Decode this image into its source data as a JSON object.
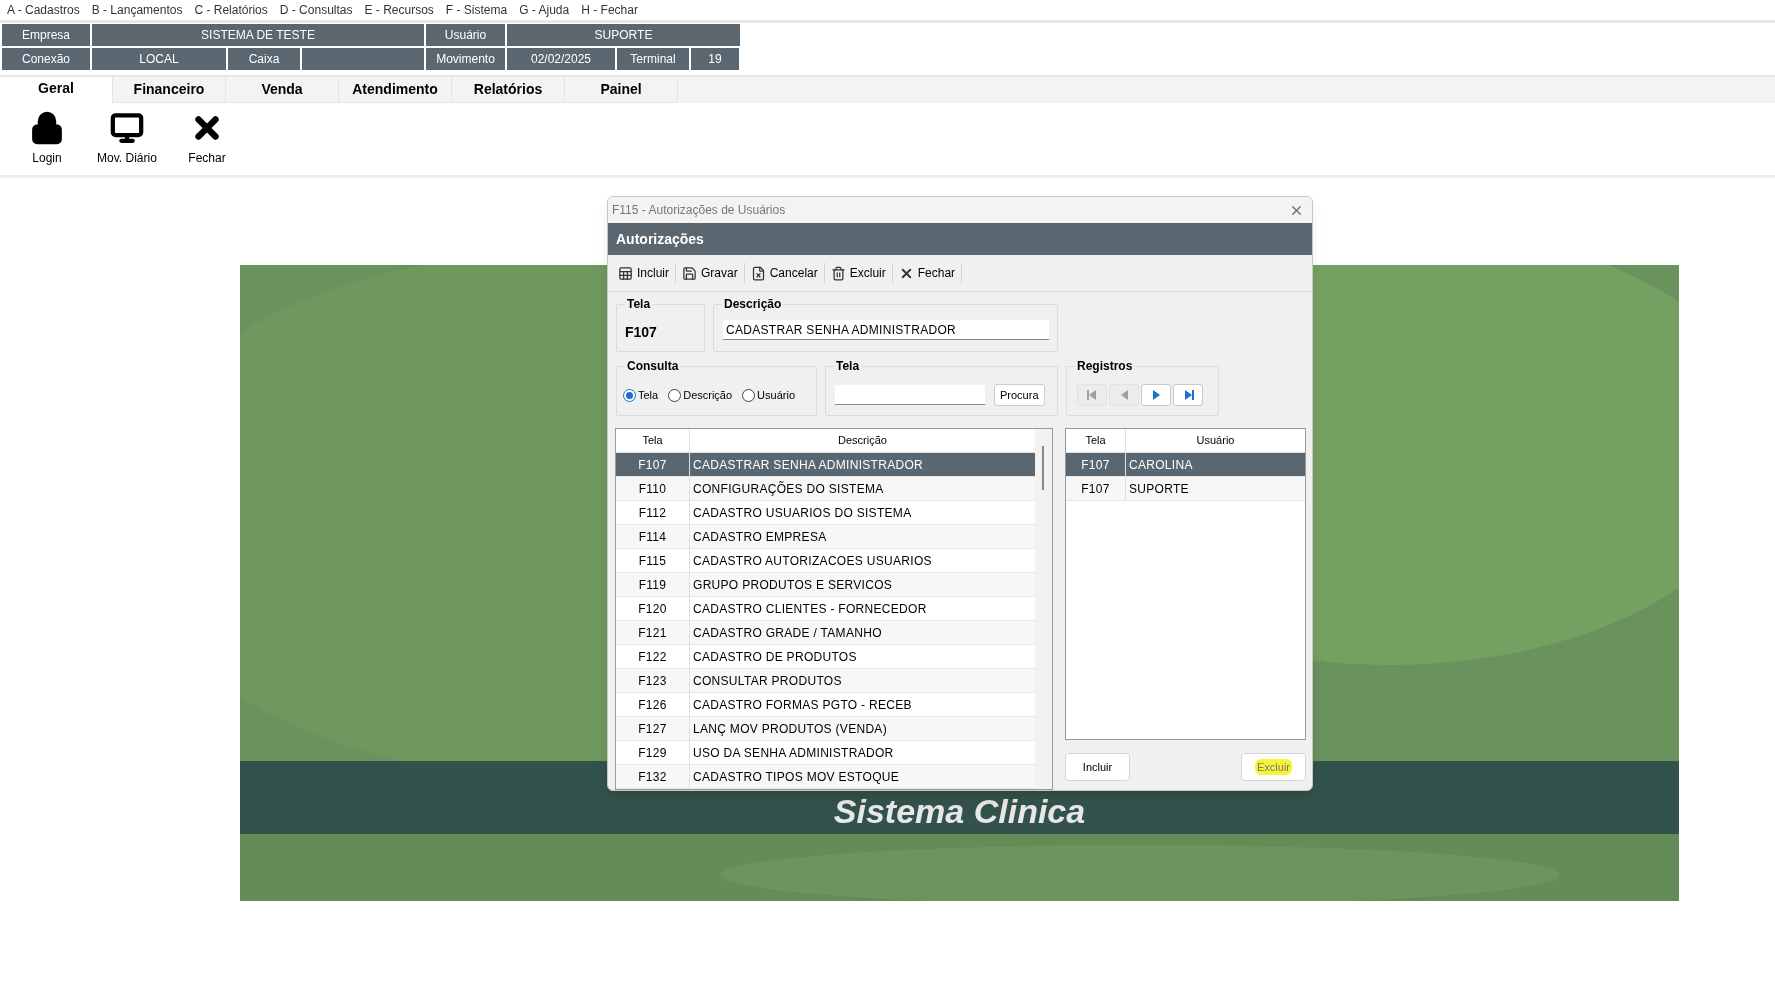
{
  "menu": [
    "A - Cadastros",
    "B - Lançamentos",
    "C - Relatórios",
    "D - Consultas",
    "E - Recursos",
    "F - Sistema",
    "G - Ajuda",
    "H - Fechar"
  ],
  "info_rows": [
    [
      "Empresa",
      "SISTEMA DE TESTE",
      "Usuário",
      "SUPORTE"
    ],
    [
      "Conexão",
      "LOCAL",
      "Caixa",
      "",
      "Movimento",
      "02/02/2025",
      "Terminal",
      "19"
    ]
  ],
  "tabs": [
    {
      "label": "Geral",
      "selected": true
    },
    {
      "label": "Financeiro",
      "selected": false
    },
    {
      "label": "Venda",
      "selected": false
    },
    {
      "label": "Atendimento",
      "selected": false
    },
    {
      "label": "Relatórios",
      "selected": false
    },
    {
      "label": "Painel",
      "selected": false
    }
  ],
  "ribbon": [
    {
      "kind": "lock",
      "label": "Login"
    },
    {
      "kind": "computer",
      "label": "Mov. Diário"
    },
    {
      "kind": "close",
      "label": "Fechar"
    }
  ],
  "background": {
    "banner_text": "Sistema Clinica"
  },
  "dialog": {
    "title": "F115 - Autorizações de Usuários",
    "header": "Autorizações",
    "toolbar": [
      {
        "kind": "add",
        "label": "Incluir"
      },
      {
        "kind": "save",
        "label": "Gravar"
      },
      {
        "kind": "cancel",
        "label": "Cancelar"
      },
      {
        "kind": "delete",
        "label": "Excluir"
      },
      {
        "kind": "close",
        "label": "Fechar"
      }
    ],
    "tela": {
      "label": "Tela",
      "value": "F107"
    },
    "descricao": {
      "label": "Descrição",
      "value": "CADASTRAR SENHA ADMINISTRADOR"
    },
    "consulta": {
      "label": "Consulta",
      "options": [
        {
          "label": "Tela",
          "selected": true
        },
        {
          "label": "Descrição",
          "selected": false
        },
        {
          "label": "Usuário",
          "selected": false
        }
      ]
    },
    "search": {
      "label": "Tela",
      "button": "Procura"
    },
    "registros": {
      "label": "Registros",
      "buttons": [
        {
          "kind": "first",
          "disabled": true
        },
        {
          "kind": "prev",
          "disabled": true
        },
        {
          "kind": "next",
          "disabled": false
        },
        {
          "kind": "last",
          "disabled": false
        }
      ]
    },
    "screens_table": {
      "columns": [
        "Tela",
        "Descrição"
      ],
      "rows": [
        {
          "cells": [
            "F107",
            "CADASTRAR SENHA ADMINISTRADOR"
          ],
          "selected": true
        },
        {
          "cells": [
            "F110",
            "CONFIGURAÇÕES DO SISTEMA"
          ],
          "selected": false
        },
        {
          "cells": [
            "F112",
            "CADASTRO USUARIOS DO SISTEMA"
          ],
          "selected": false
        },
        {
          "cells": [
            "F114",
            "CADASTRO EMPRESA"
          ],
          "selected": false
        },
        {
          "cells": [
            "F115",
            "CADASTRO AUTORIZACOES USUARIOS"
          ],
          "selected": false
        },
        {
          "cells": [
            "F119",
            "GRUPO PRODUTOS E SERVICOS"
          ],
          "selected": false
        },
        {
          "cells": [
            "F120",
            "CADASTRO CLIENTES - FORNECEDOR"
          ],
          "selected": false
        },
        {
          "cells": [
            "F121",
            "CADASTRO GRADE / TAMANHO"
          ],
          "selected": false
        },
        {
          "cells": [
            "F122",
            "CADASTRO DE PRODUTOS"
          ],
          "selected": false
        },
        {
          "cells": [
            "F123",
            "CONSULTAR PRODUTOS"
          ],
          "selected": false
        },
        {
          "cells": [
            "F126",
            "CADASTRO FORMAS PGTO - RECEB"
          ],
          "selected": false
        },
        {
          "cells": [
            "F127",
            "LANÇ MOV PRODUTOS (VENDA)"
          ],
          "selected": false
        },
        {
          "cells": [
            "F129",
            "USO DA SENHA ADMINISTRADOR"
          ],
          "selected": false
        },
        {
          "cells": [
            "F132",
            "CADASTRO TIPOS MOV ESTOQUE"
          ],
          "selected": false
        }
      ]
    },
    "users_table": {
      "columns": [
        "Tela",
        "Usuário"
      ],
      "rows": [
        {
          "cells": [
            "F107",
            "CAROLINA"
          ],
          "selected": true
        },
        {
          "cells": [
            "F107",
            "SUPORTE"
          ],
          "selected": false
        }
      ]
    },
    "buttons": [
      {
        "label": "Incluir",
        "highlighted": false
      },
      {
        "label": "Excluir",
        "highlighted": true
      }
    ]
  }
}
